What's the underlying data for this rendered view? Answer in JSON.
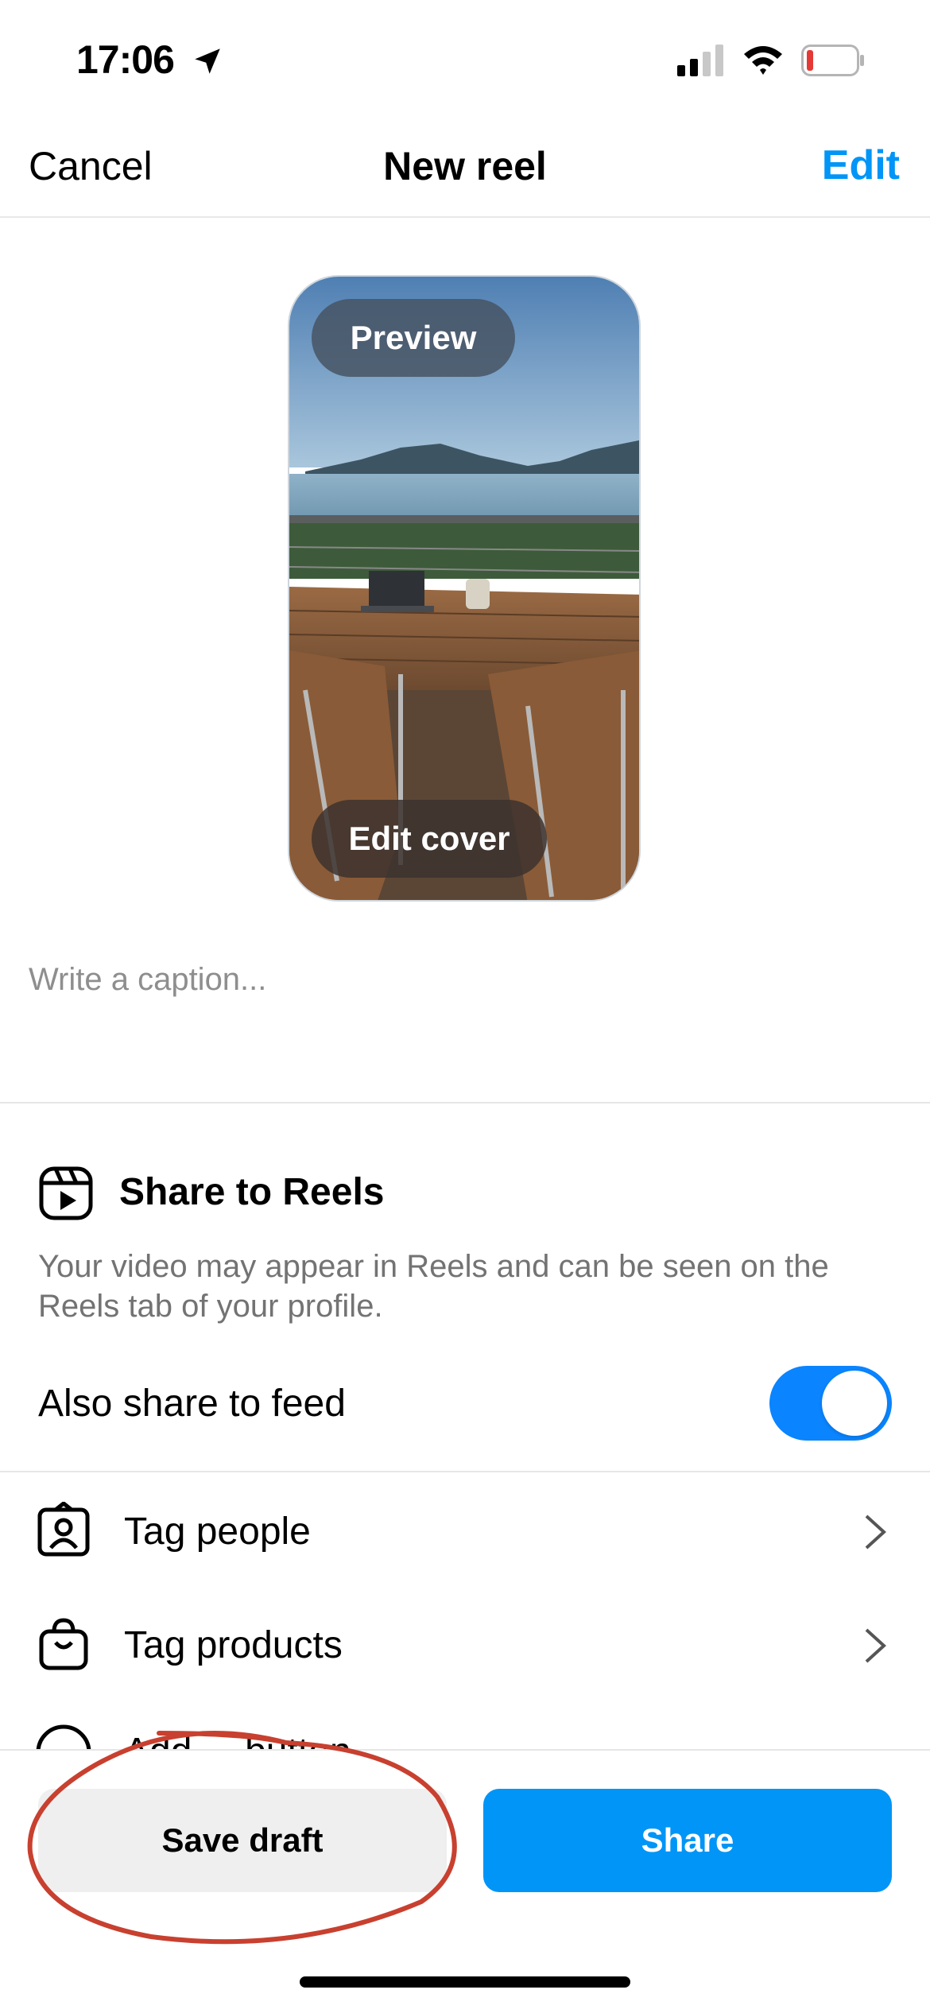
{
  "status_bar": {
    "time": "17:06",
    "icons": [
      "location-arrow-icon",
      "cellular-signal-icon",
      "wifi-icon",
      "battery-low-icon"
    ],
    "battery_color": "#e53935"
  },
  "header": {
    "cancel_label": "Cancel",
    "title": "New reel",
    "edit_label": "Edit",
    "accent_color": "#0095f6"
  },
  "preview": {
    "preview_label": "Preview",
    "edit_cover_label": "Edit cover"
  },
  "caption": {
    "placeholder": "Write a caption..."
  },
  "share_to_reels": {
    "title": "Share to Reels",
    "description": "Your video may appear in Reels and can be seen on the Reels tab of your profile.",
    "icon": "reels-icon"
  },
  "feed_toggle": {
    "label": "Also share to feed",
    "on": true,
    "color": "#0a84ff"
  },
  "rows": [
    {
      "label": "Tag people",
      "icon": "tag-people-icon"
    },
    {
      "label": "Tag products",
      "icon": "shopping-bag-icon"
    },
    {
      "label": "Add ... button",
      "icon": "circle-icon"
    }
  ],
  "footer": {
    "save_draft_label": "Save draft",
    "share_label": "Share",
    "annotation_color": "#c8402f"
  }
}
